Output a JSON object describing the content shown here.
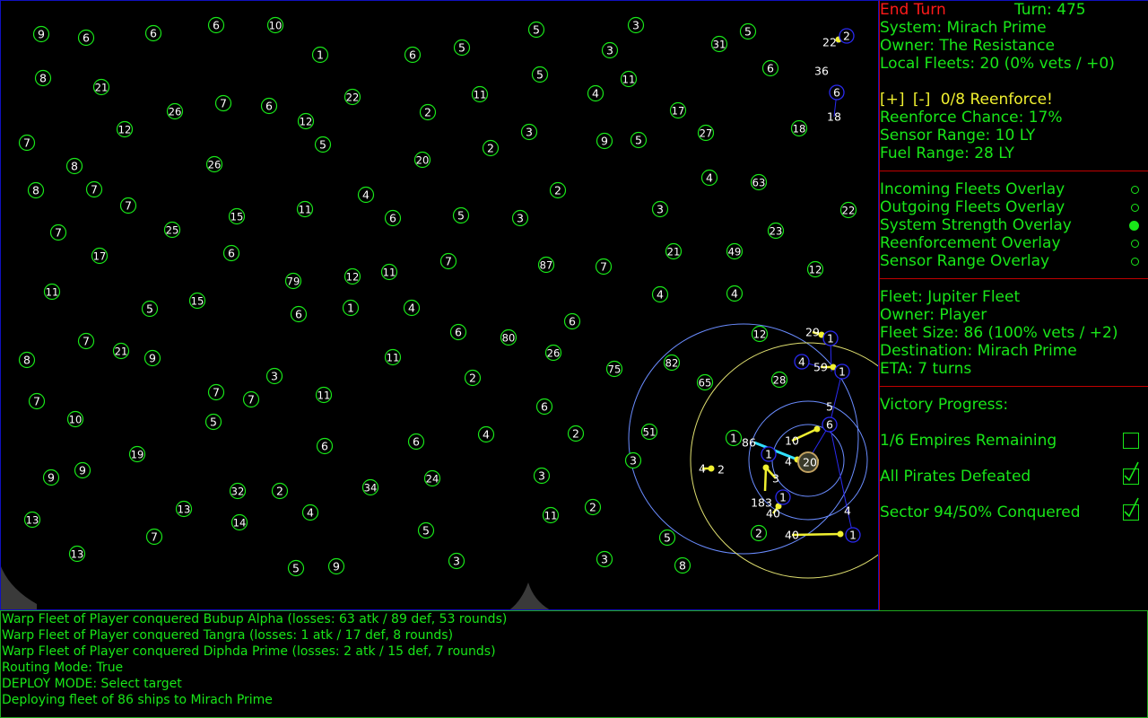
{
  "map": {
    "colors": {
      "green": "#19e619",
      "blue": "#2a2af0",
      "yellow": "#f0f030",
      "lightblue": "#6a8cff",
      "cyan": "#30e0ff",
      "white": "#ffffff"
    },
    "green_systems": [
      [
        "9",
        45,
        37
      ],
      [
        "6",
        95,
        41
      ],
      [
        "6",
        170,
        36
      ],
      [
        "6",
        240,
        27
      ],
      [
        "10",
        306,
        27
      ],
      [
        "1",
        356,
        60
      ],
      [
        "6",
        459,
        60
      ],
      [
        "5",
        514,
        52
      ],
      [
        "5",
        597,
        32
      ],
      [
        "3",
        679,
        55
      ],
      [
        "3",
        708,
        27
      ],
      [
        "31",
        801,
        48
      ],
      [
        "5",
        833,
        34
      ],
      [
        "8",
        47,
        86
      ],
      [
        "21",
        112,
        96
      ],
      [
        "7",
        248,
        114
      ],
      [
        "6",
        299,
        117
      ],
      [
        "12",
        340,
        134
      ],
      [
        "22",
        392,
        107
      ],
      [
        "2",
        476,
        124
      ],
      [
        "11",
        534,
        104
      ],
      [
        "5",
        601,
        82
      ],
      [
        "4",
        663,
        103
      ],
      [
        "11",
        700,
        87
      ],
      [
        "6",
        858,
        75
      ],
      [
        "26",
        194,
        123
      ],
      [
        "12",
        138,
        143
      ],
      [
        "5",
        359,
        160
      ],
      [
        "3",
        589,
        146
      ],
      [
        "9",
        673,
        156
      ],
      [
        "5",
        711,
        155
      ],
      [
        "17",
        755,
        122
      ],
      [
        "27",
        786,
        147
      ],
      [
        "18",
        890,
        142
      ],
      [
        "7",
        29,
        158
      ],
      [
        "8",
        82,
        184
      ],
      [
        "26",
        238,
        182
      ],
      [
        "20",
        470,
        177
      ],
      [
        "2",
        546,
        164
      ],
      [
        "4",
        790,
        197
      ],
      [
        "63",
        845,
        202
      ],
      [
        "8",
        39,
        211
      ],
      [
        "7",
        104,
        210
      ],
      [
        "7",
        142,
        228
      ],
      [
        "15",
        263,
        240
      ],
      [
        "11",
        339,
        232
      ],
      [
        "4",
        407,
        216
      ],
      [
        "6",
        437,
        242
      ],
      [
        "5",
        513,
        239
      ],
      [
        "3",
        579,
        242
      ],
      [
        "2",
        621,
        211
      ],
      [
        "3",
        735,
        232
      ],
      [
        "23",
        864,
        256
      ],
      [
        "22",
        945,
        233
      ],
      [
        "7",
        64,
        258
      ],
      [
        "25",
        191,
        255
      ],
      [
        "17",
        110,
        284
      ],
      [
        "6",
        257,
        281
      ],
      [
        "21",
        750,
        279
      ],
      [
        "49",
        818,
        279
      ],
      [
        "11",
        57,
        324
      ],
      [
        "79",
        326,
        312
      ],
      [
        "12",
        392,
        307
      ],
      [
        "11",
        433,
        302
      ],
      [
        "7",
        499,
        290
      ],
      [
        "87",
        608,
        294
      ],
      [
        "7",
        672,
        296
      ],
      [
        "12",
        908,
        299
      ],
      [
        "5",
        166,
        343
      ],
      [
        "15",
        219,
        334
      ],
      [
        "6",
        332,
        349
      ],
      [
        "1",
        390,
        342
      ],
      [
        "4",
        458,
        342
      ],
      [
        "4",
        735,
        327
      ],
      [
        "4",
        818,
        326
      ],
      [
        "7",
        95,
        379
      ],
      [
        "21",
        134,
        390
      ],
      [
        "9",
        169,
        398
      ],
      [
        "6",
        510,
        369
      ],
      [
        "80",
        566,
        375
      ],
      [
        "6",
        637,
        357
      ],
      [
        "26",
        616,
        392
      ],
      [
        "12",
        846,
        371
      ],
      [
        "8",
        29,
        400
      ],
      [
        "11",
        437,
        397
      ],
      [
        "2",
        526,
        420
      ],
      [
        "75",
        684,
        410
      ],
      [
        "82",
        748,
        403
      ],
      [
        "3",
        305,
        418
      ],
      [
        "28",
        868,
        422
      ],
      [
        "65",
        785,
        425
      ],
      [
        "7",
        40,
        446
      ],
      [
        "7",
        240,
        436
      ],
      [
        "7",
        279,
        444
      ],
      [
        "11",
        360,
        439
      ],
      [
        "10",
        83,
        466
      ],
      [
        "5",
        237,
        469
      ],
      [
        "6",
        606,
        452
      ],
      [
        "51",
        723,
        480
      ],
      [
        "2",
        641,
        482
      ],
      [
        "4",
        541,
        483
      ],
      [
        "6",
        361,
        496
      ],
      [
        "6",
        463,
        491
      ],
      [
        "19",
        152,
        505
      ],
      [
        "3",
        705,
        512
      ],
      [
        "9",
        56,
        531
      ],
      [
        "9",
        91,
        523
      ],
      [
        "32",
        264,
        546
      ],
      [
        "2",
        311,
        546
      ],
      [
        "34",
        412,
        542
      ],
      [
        "24",
        481,
        532
      ],
      [
        "3",
        603,
        529
      ],
      [
        "13",
        35,
        578
      ],
      [
        "13",
        204,
        566
      ],
      [
        "14",
        266,
        581
      ],
      [
        "4",
        345,
        570
      ],
      [
        "2",
        660,
        564
      ],
      [
        "11",
        613,
        573
      ],
      [
        "5",
        474,
        590
      ],
      [
        "7",
        171,
        597
      ],
      [
        "5",
        743,
        598
      ],
      [
        "13",
        85,
        616
      ],
      [
        "5",
        329,
        632
      ],
      [
        "9",
        374,
        630
      ],
      [
        "3",
        508,
        624
      ],
      [
        "3",
        673,
        622
      ],
      [
        "8",
        760,
        629
      ],
      [
        "2",
        845,
        593
      ],
      [
        "1",
        817,
        487
      ]
    ],
    "blue_systems": [
      [
        "2",
        943,
        39
      ],
      [
        "6",
        932,
        102
      ],
      [
        "1",
        925,
        376
      ],
      [
        "1",
        938,
        413
      ],
      [
        "6",
        924,
        472
      ],
      [
        "1",
        950,
        595
      ],
      [
        "1",
        856,
        505
      ],
      [
        "1",
        872,
        553
      ],
      [
        "4",
        893,
        402
      ]
    ],
    "plain_labels": [
      [
        "22",
        924,
        46
      ],
      [
        "36",
        915,
        78
      ],
      [
        "18",
        929,
        129
      ],
      [
        "29",
        905,
        369
      ],
      [
        "59",
        914,
        408
      ],
      [
        "5",
        924,
        452
      ],
      [
        "10",
        882,
        490
      ],
      [
        "86",
        834,
        492
      ],
      [
        "4",
        878,
        513
      ],
      [
        "20",
        902,
        514
      ],
      [
        "4",
        782,
        521
      ],
      [
        "2",
        803,
        522
      ],
      [
        "3",
        864,
        532
      ],
      [
        "183",
        848,
        559
      ],
      [
        "40",
        861,
        571
      ],
      [
        "4",
        944,
        568
      ],
      [
        "40",
        882,
        595
      ]
    ],
    "selected_label": "20"
  },
  "panel": {
    "end_turn": "End Turn",
    "turn": "Turn: 475",
    "system": "System: Mirach Prime",
    "owner": "Owner: The Resistance",
    "local_fleets": "Local Fleets: 20 (0% vets / +0)",
    "reenforce_plus": "[+]",
    "reenforce_minus": "[-]",
    "reenforce_count": "0/8 Reenforce!",
    "reenforce_chance": "Reenforce Chance: 17%",
    "sensor_range": "Sensor Range: 10 LY",
    "fuel_range": "Fuel Range: 28 LY",
    "overlays": [
      {
        "label": "Incoming Fleets Overlay",
        "on": false
      },
      {
        "label": "Outgoing Fleets Overlay",
        "on": false
      },
      {
        "label": "System Strength Overlay",
        "on": true
      },
      {
        "label": "Reenforcement Overlay",
        "on": false
      },
      {
        "label": "Sensor Range Overlay",
        "on": false
      }
    ],
    "fleet": {
      "name": "Fleet: Jupiter Fleet",
      "owner": "Owner: Player",
      "size": "Fleet Size: 86 (100% vets / +2)",
      "destination": "Destination: Mirach Prime",
      "eta": "ETA: 7 turns"
    },
    "victory": {
      "title": "Victory Progress:",
      "items": [
        {
          "label": "1/6 Empires Remaining",
          "checked": false
        },
        {
          "label": "All Pirates Defeated",
          "checked": true
        },
        {
          "label": "Sector 94/50% Conquered",
          "checked": true
        }
      ]
    }
  },
  "log": [
    "Warp Fleet of Player conquered Bubup Alpha (losses: 63 atk / 89 def, 53 rounds)",
    "Warp Fleet of Player conquered Tangra (losses: 1 atk / 17 def, 8 rounds)",
    "Warp Fleet of Player conquered Diphda Prime (losses: 2 atk / 15 def, 7 rounds)",
    "Routing Mode: True",
    "DEPLOY MODE: Select target",
    "Deploying fleet of 86 ships to Mirach Prime"
  ]
}
